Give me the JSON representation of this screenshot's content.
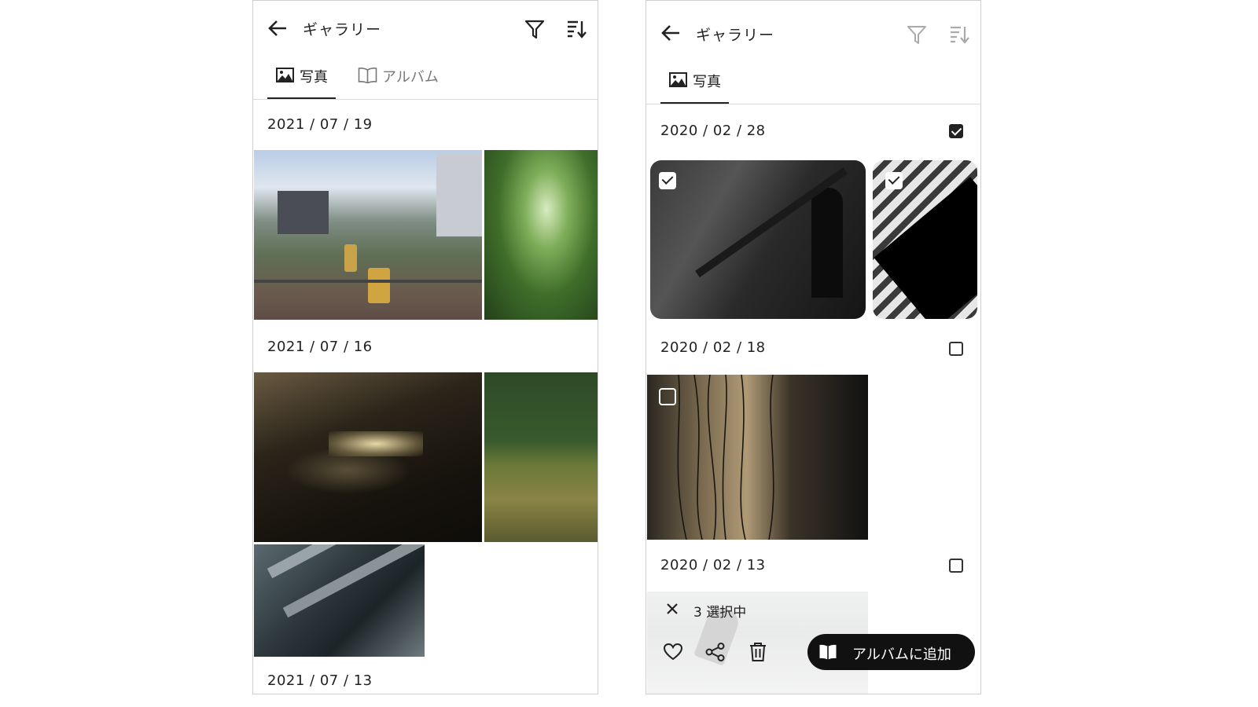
{
  "left": {
    "header": {
      "title": "ギャラリー"
    },
    "tabs": [
      {
        "label": "写真",
        "active": true
      },
      {
        "label": "アルバム",
        "active": false
      }
    ],
    "sections": [
      {
        "date": "2021 / 07 / 19"
      },
      {
        "date": "2021 / 07 / 16"
      },
      {
        "date": "2021 / 07 / 13"
      }
    ]
  },
  "right": {
    "header": {
      "title": "ギャラリー"
    },
    "tabs": [
      {
        "label": "写真",
        "active": true
      }
    ],
    "sections": [
      {
        "date": "2020 / 02 / 28",
        "checked": true
      },
      {
        "date": "2020 / 02 / 18",
        "checked": false
      },
      {
        "date": "2020 / 02 / 13",
        "checked": false
      }
    ],
    "selection": {
      "count_label": "3 選択中",
      "add_album_label": "アルバムに追加"
    }
  },
  "colors": {
    "accent": "#222222",
    "divider": "#dcdcdc",
    "pill": "#111111"
  }
}
